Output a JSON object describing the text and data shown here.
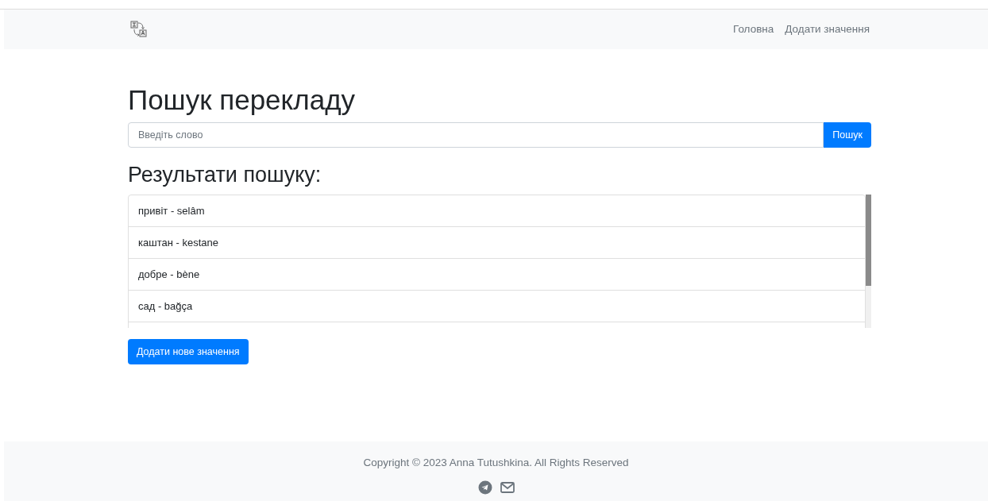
{
  "nav": {
    "links": [
      "Головна",
      "Додати значення"
    ]
  },
  "title": "Пошук перекладу",
  "search": {
    "placeholder": "Введіть слово",
    "button": "Пошук"
  },
  "results_title": "Результати пошуку:",
  "results": [
    "привіт - selâm",
    "каштан - kestane",
    "добре - bène",
    "сад - bağça"
  ],
  "add_button": "Додати нове значення",
  "footer": {
    "copyright": "Copyright © 2023 Anna Tutushkina. All Rights Reserved"
  }
}
